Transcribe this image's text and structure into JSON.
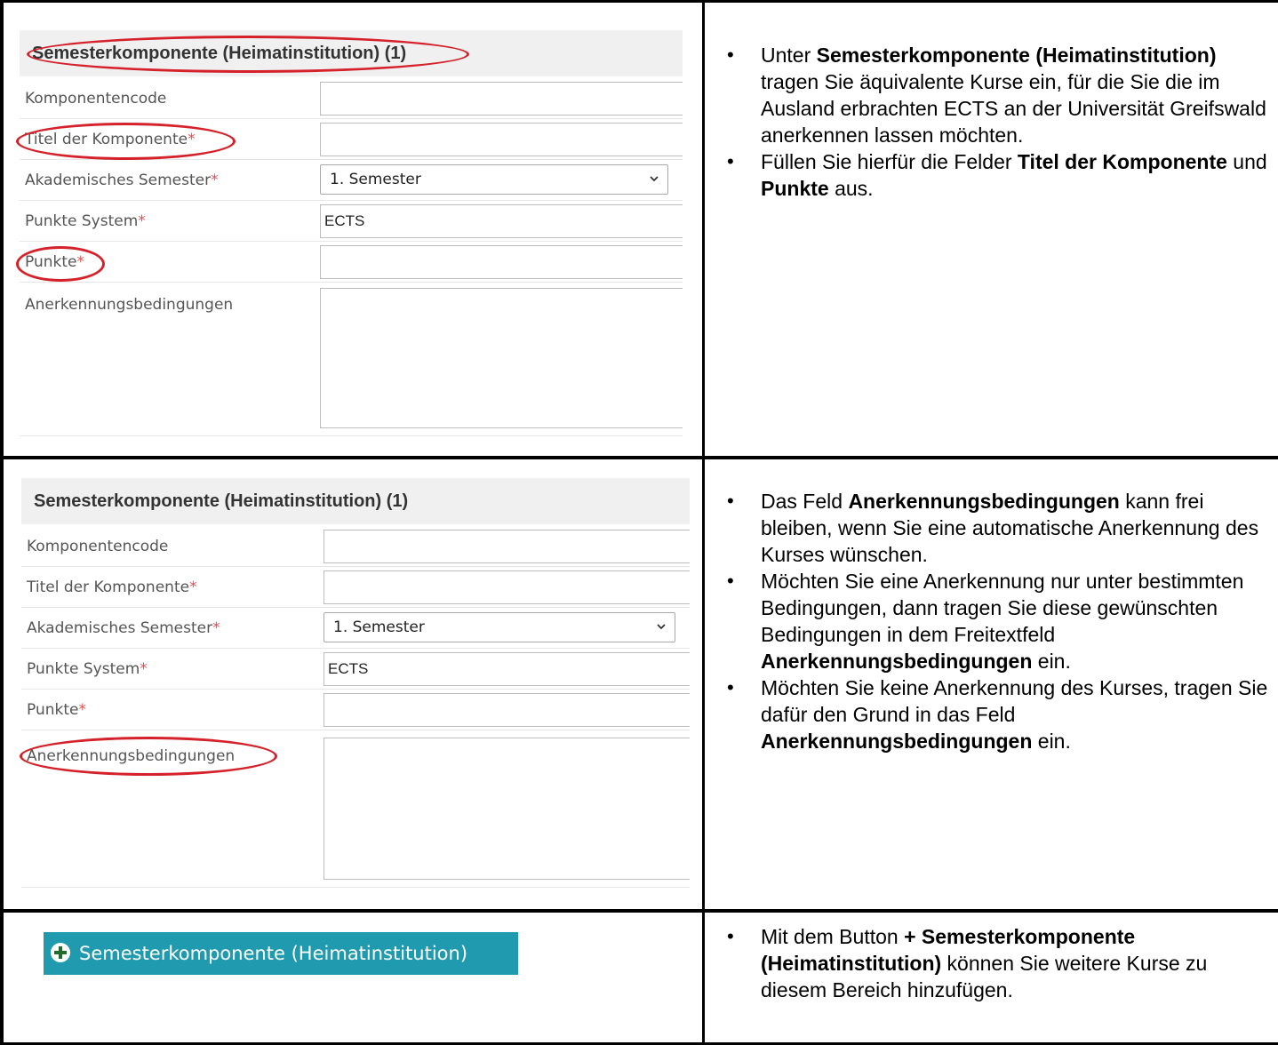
{
  "form1": {
    "header": "Semesterkomponente (Heimatinstitution) (1)",
    "fields": {
      "code": {
        "label": "Komponentencode",
        "required": ""
      },
      "title": {
        "label": "Titel der Komponente",
        "required": "*"
      },
      "semester": {
        "label": "Akademisches Semester",
        "required": "*",
        "value": "1. Semester"
      },
      "system": {
        "label": "Punkte System",
        "required": "*",
        "value": "ECTS"
      },
      "points": {
        "label": "Punkte",
        "required": "*"
      },
      "conditions": {
        "label": "Anerkennungsbedingungen",
        "required": ""
      }
    }
  },
  "form2": {
    "header": "Semesterkomponente (Heimatinstitution) (1)",
    "fields": {
      "code": {
        "label": "Komponentencode",
        "required": ""
      },
      "title": {
        "label": "Titel der Komponente",
        "required": "*"
      },
      "semester": {
        "label": "Akademisches Semester",
        "required": "*",
        "value": "1. Semester"
      },
      "system": {
        "label": "Punkte System",
        "required": "*",
        "value": "ECTS"
      },
      "points": {
        "label": "Punkte",
        "required": "*"
      },
      "conditions": {
        "label": "Anerkennungsbedingungen",
        "required": ""
      }
    }
  },
  "notes1": {
    "b1_pre": "Unter ",
    "b1_bold": "Semesterkomponente (Heimatinstitution)",
    "b1_post": " tragen Sie äquivalente Kurse ein, für die Sie die im Ausland erbrachten ECTS an der Universität Greifswald anerkennen lassen möchten.",
    "b2_pre": "Füllen Sie hierfür die Felder ",
    "b2_bold1": "Titel der Komponente",
    "b2_mid": " und ",
    "b2_bold2": "Punkte",
    "b2_post": " aus."
  },
  "notes2": {
    "b1_pre": "Das Feld ",
    "b1_bold": "Anerkennungsbedingungen",
    "b1_post": " kann frei bleiben, wenn Sie eine automatische Anerkennung des Kurses wünschen.",
    "b2_pre": "Möchten Sie eine Anerkennung nur unter bestimmten Bedingungen, dann tragen Sie diese gewünschten Bedingungen in dem Freitextfeld ",
    "b2_bold": "Anerkennungsbedingungen",
    "b2_post": " ein.",
    "b3_pre": "Möchten Sie keine Anerkennung des Kurses, tragen Sie dafür den Grund in das Feld ",
    "b3_bold": "Anerkennungsbedingungen",
    "b3_post": " ein."
  },
  "notes3": {
    "b1_pre": "Mit dem Button ",
    "b1_bold": "+ Semesterkomponente (Heimatinstitution)",
    "b1_post": " können Sie weitere Kurse zu diesem Bereich hinzufügen."
  },
  "add_button": {
    "label": "Semesterkomponente (Heimatinstitution)",
    "icon": "plus-circle-icon"
  },
  "colors": {
    "highlight": "#d4212a",
    "button": "#1f9aae",
    "required": "#e05050"
  }
}
